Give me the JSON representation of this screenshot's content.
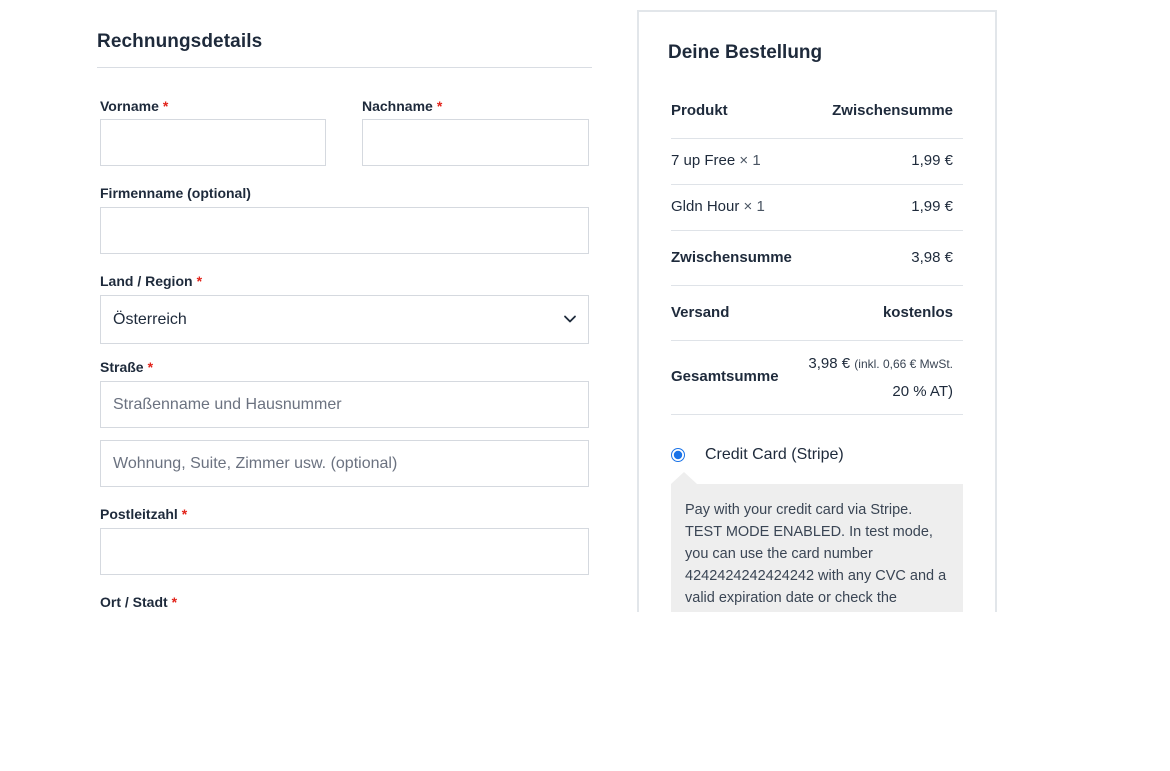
{
  "billing": {
    "title": "Rechnungsdetails",
    "required_marker": "*",
    "first_name": {
      "label": "Vorname",
      "value": ""
    },
    "last_name": {
      "label": "Nachname",
      "value": ""
    },
    "company": {
      "label": "Firmenname (optional)",
      "value": ""
    },
    "country": {
      "label": "Land / Region",
      "value": "Österreich"
    },
    "street": {
      "label": "Straße",
      "placeholder1": "Straßenname und Hausnummer",
      "placeholder2": "Wohnung, Suite, Zimmer usw. (optional)"
    },
    "postcode": {
      "label": "Postleitzahl",
      "value": ""
    },
    "city": {
      "label": "Ort / Stadt"
    }
  },
  "order": {
    "title": "Deine Bestellung",
    "col_product": "Produkt",
    "col_subtotal": "Zwischensumme",
    "items": [
      {
        "name": "7 up Free",
        "qty": "× 1",
        "price": "1,99 €"
      },
      {
        "name": "Gldn Hour",
        "qty": "× 1",
        "price": "1,99 €"
      }
    ],
    "subtotal_label": "Zwischensumme",
    "subtotal_value": "3,98 €",
    "shipping_label": "Versand",
    "shipping_value": "kostenlos",
    "total_label": "Gesamtsumme",
    "total_value": "3,98 €",
    "tax_note_line1": "(inkl. 0,66 € MwSt.",
    "tax_note_line2": "20 % AT)"
  },
  "payment": {
    "method_label": "Credit Card (Stripe)",
    "description": "Pay with your credit card via Stripe. TEST MODE ENABLED. In test mode, you can use the card number 4242424242424242 with any CVC and a valid expiration date or check the"
  },
  "colors": {
    "text": "#1e2a3b",
    "required": "#e2231a",
    "radio": "#1a73e8",
    "payment_box": "#eeeeee"
  }
}
